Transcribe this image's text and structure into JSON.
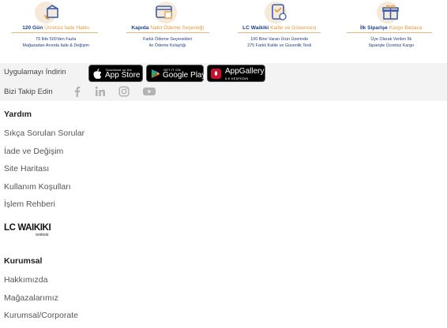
{
  "features": [
    {
      "title_main": "120 Gün",
      "title_highlight": "Ücretsiz İade Hakkı",
      "desc_lines": [
        "79 İlde 500'den Fazla",
        "Mağazadan Anında İade & Değişim"
      ],
      "icon": "box-return-icon"
    },
    {
      "title_main": "Kapıda",
      "title_highlight": "Nakit Ödeme Seçeneği",
      "desc_lines": [
        "Farklı Ödeme Seçenekleri",
        "ile Ödeme Kolaylığı"
      ],
      "icon": "card-payment-icon"
    },
    {
      "title_main": "LC Waikiki",
      "title_highlight": "Kalite ve Güvencesi",
      "desc_lines": [
        "100 Bine Varan Ürün Üzerinde",
        "275 Farklı Kalite ve Güvenlik Testi"
      ],
      "icon": "quality-badge-icon"
    },
    {
      "title_main": "İlk Siparişe",
      "title_highlight": "Kargo Bedava",
      "desc_lines": [
        "Üye Olarak Verilen İlk",
        "Siparişte Ücretsiz Kargo"
      ],
      "icon": "gift-box-icon"
    }
  ],
  "apps": {
    "label": "Uygulamayı İndirin",
    "stores": [
      {
        "small": "Download on the",
        "big": "App Store",
        "icon": "apple-icon"
      },
      {
        "small": "GET IT ON",
        "big": "Google Play",
        "icon": "google-play-icon"
      },
      {
        "small": "İLE KEŞFEDİN",
        "big": "AppGallery",
        "icon": "huawei-icon"
      }
    ]
  },
  "social": {
    "label": "Bizi Takip Edin",
    "icons": [
      "facebook-icon",
      "linkedin-icon",
      "instagram-icon",
      "youtube-icon"
    ]
  },
  "help": {
    "heading": "Yardım",
    "links": [
      "Sıkça Sorulan Sorular",
      "İade ve Değişim",
      "Site Haritası",
      "Kullanım Koşulları",
      "İşlem Rehberi"
    ]
  },
  "logo": {
    "line1": "LC WAIKIKI",
    "line2": "waiwai"
  },
  "corporate": {
    "heading": "Kurumsal",
    "links": [
      "Hakkımızda",
      "Mağazalarımız",
      "Kurumsal/Corporate"
    ]
  },
  "colors": {
    "brand_blue": "#1f3f8a",
    "accent_orange": "#e39b3c",
    "band_grey": "#f3f3f3"
  }
}
